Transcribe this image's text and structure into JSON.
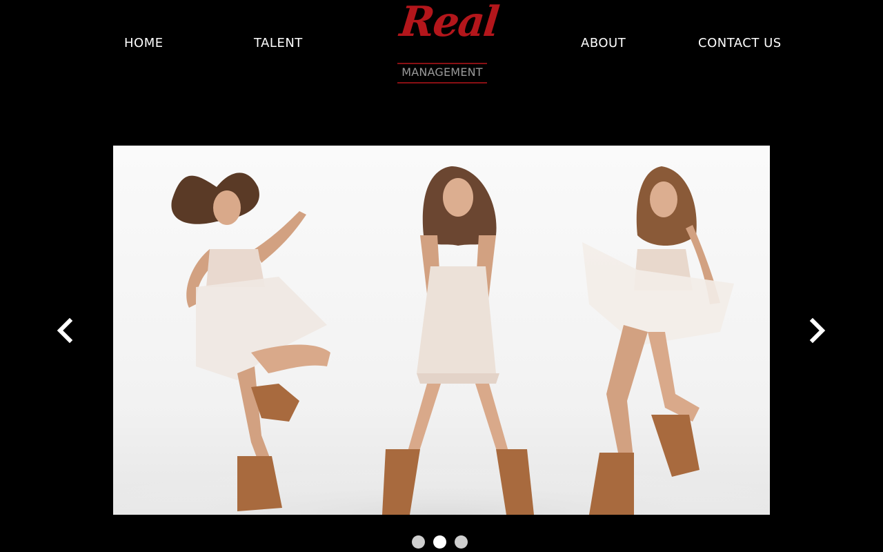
{
  "nav": {
    "home": "HOME",
    "talent": "TALENT",
    "about": "ABOUT",
    "contact": "CONTACT US"
  },
  "logo": {
    "script_text": "Real",
    "subtitle": "MANAGEMENT",
    "brand_color": "#b3161b",
    "subtitle_color": "#9a9a9a"
  },
  "carousel": {
    "image_description_icon": "fashion-photo-three-models",
    "prev_icon": "chevron-left-icon",
    "next_icon": "chevron-right-icon",
    "slides_count": 3,
    "active_index": 1
  },
  "colors": {
    "background": "#000000",
    "nav_text": "#ffffff",
    "dot_inactive": "#cfcfcf",
    "dot_active": "#ffffff"
  }
}
